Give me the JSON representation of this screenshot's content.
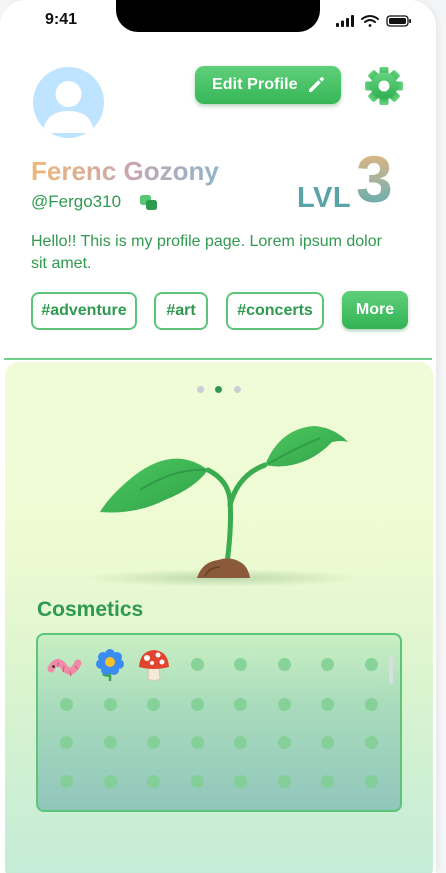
{
  "status_bar": {
    "time": "9:41"
  },
  "profile": {
    "edit_label": "Edit Profile",
    "name": "Ferenc Gozony",
    "handle": "@Fergo310",
    "level_label": "LVL",
    "level_value": "3",
    "bio": "Hello!! This is my profile page. Lorem ipsum dolor sit amet.",
    "tags": [
      "#adventure",
      "#art",
      "#concerts"
    ],
    "more_label": "More"
  },
  "carousel": {
    "page_count": 3,
    "active_index": 1
  },
  "cosmetics": {
    "title": "Cosmetics",
    "items": [
      "worm-icon",
      "blue-flower-icon",
      "mushroom-icon"
    ],
    "slots_visible": 32
  },
  "colors": {
    "accent_green": "#36b657",
    "text_green": "#2f9a4f",
    "level_teal": "#5aa3a8"
  }
}
